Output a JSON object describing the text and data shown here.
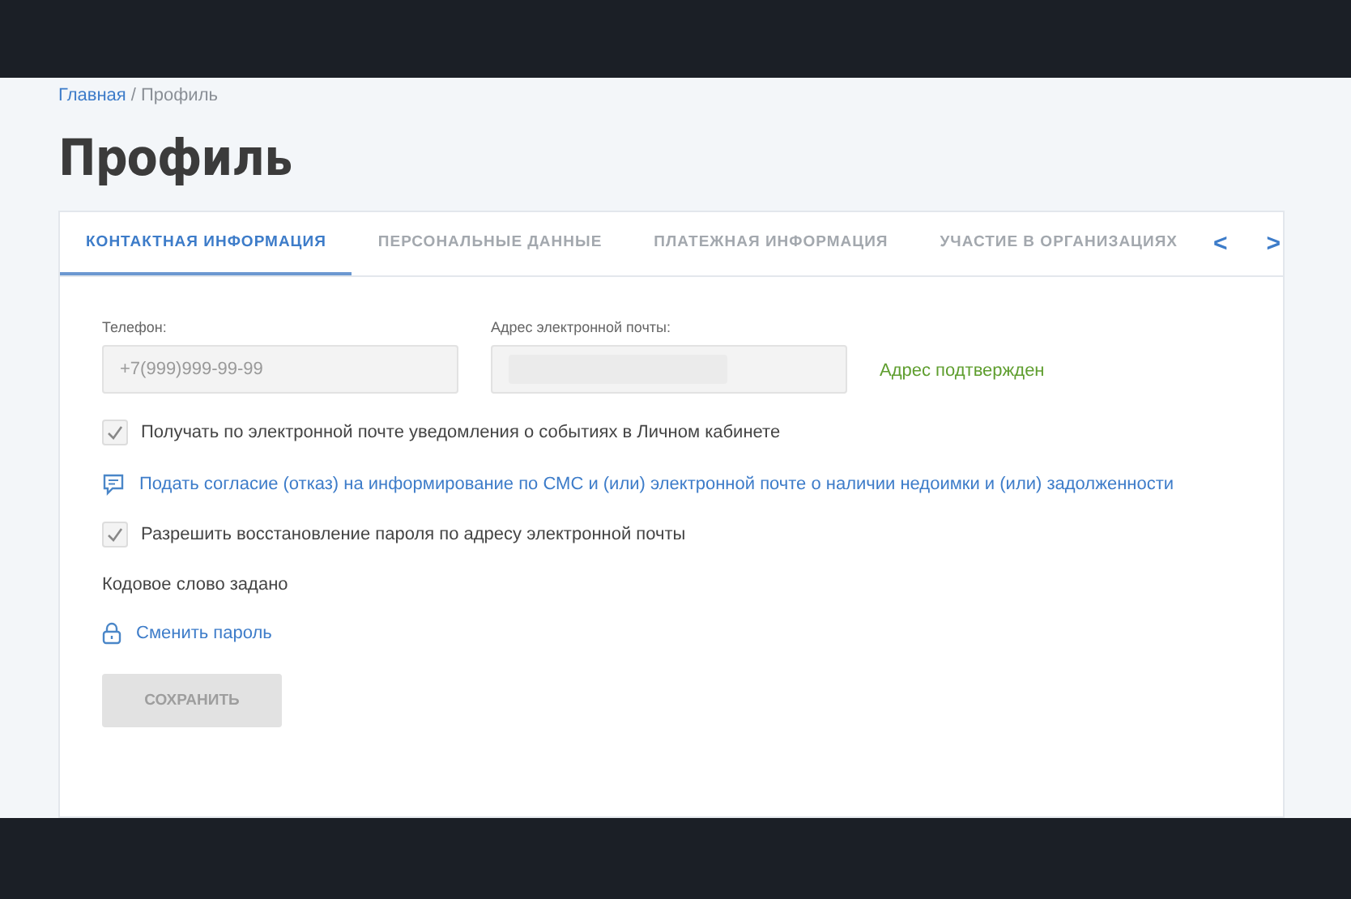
{
  "breadcrumb": [
    {
      "label": "Главная",
      "kind": "link"
    },
    {
      "label": "/ Профиль",
      "kind": "current"
    }
  ],
  "title": "Профиль",
  "tabs": [
    {
      "label": "КОНТАКТНАЯ ИНФОРМАЦИЯ",
      "selected": true
    },
    {
      "label": "ПЕРСОНАЛЬНЫЕ ДАННЫЕ",
      "selected": false
    },
    {
      "label": "ПЛАТЕЖНАЯ ИНФОРМАЦИЯ",
      "selected": false
    },
    {
      "label": "УЧАСТИЕ В ОРГАНИЗАЦИЯХ",
      "selected": false
    }
  ],
  "tab_nav": [
    "<",
    ">"
  ],
  "phone": {
    "label": "Телефон:",
    "placeholder": "+7(999)999-99-99"
  },
  "email": {
    "label": "Адрес электронной почты:",
    "status": "Адрес подтвержден"
  },
  "notify_checkbox": {
    "label": "Получать по электронной почте уведомления о событиях в Личном кабинете",
    "checked": true
  },
  "consent_link": "Подать согласие (отказ) на информирование по СМС и (или) электронной почте о наличии недоимки и (или) задолженности",
  "recovery_checkbox": {
    "label": "Разрешить восстановление пароля по адресу электронной почты",
    "checked": true
  },
  "code_word": "Кодовое слово задано",
  "change_password_link": "Сменить пароль",
  "save_button": {
    "label": "СОХРАНИТЬ",
    "disabled": true
  }
}
